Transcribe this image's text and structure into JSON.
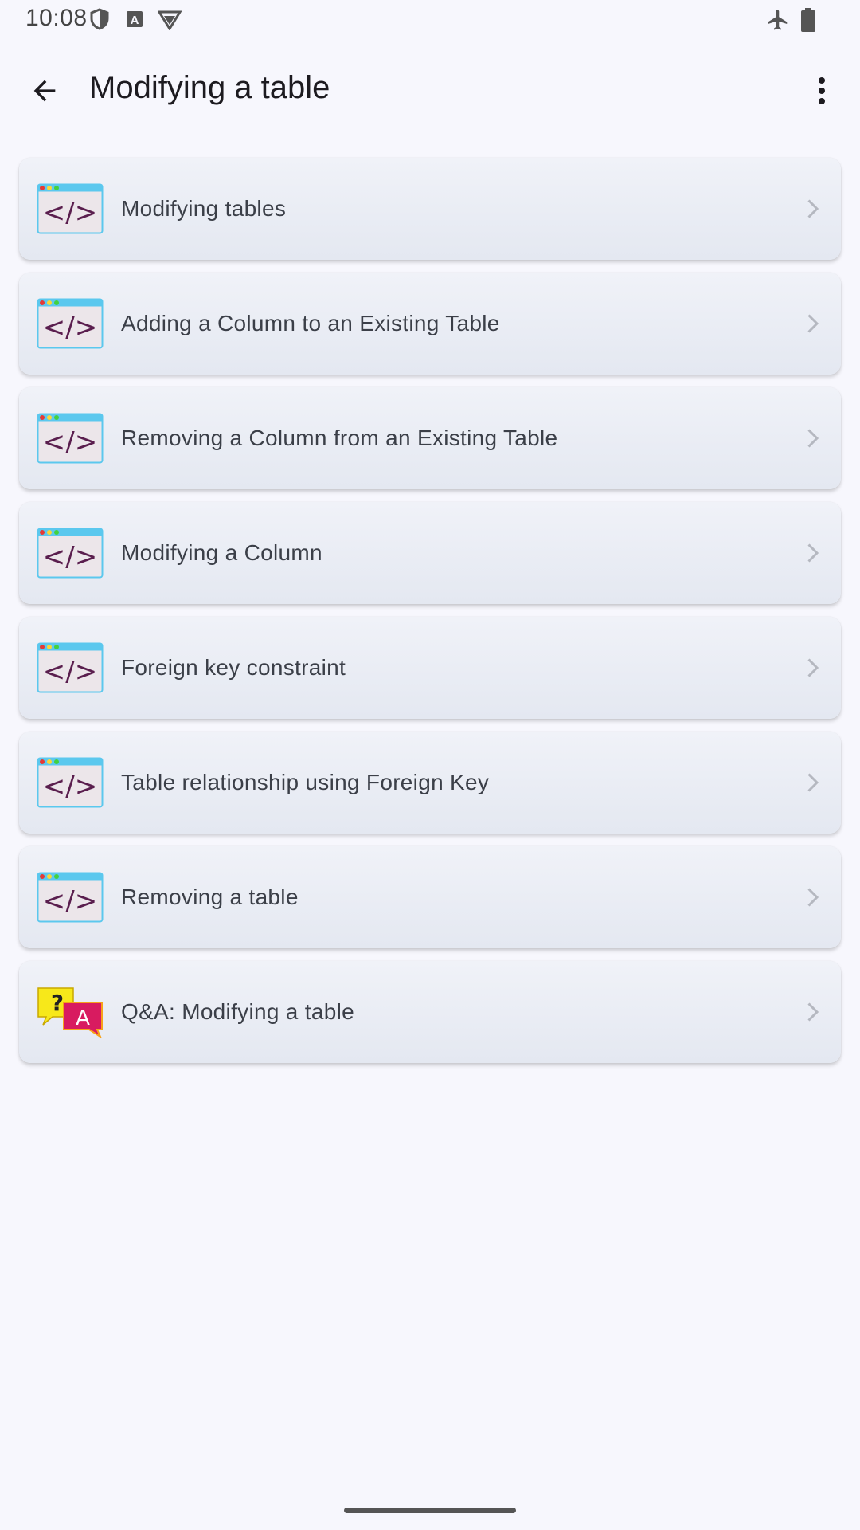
{
  "status_bar": {
    "time": "10:08",
    "left_icons": [
      "shield-icon",
      "font-a-icon",
      "vpn-triangle-icon"
    ],
    "right_icons": [
      "airplane-icon",
      "battery-icon"
    ]
  },
  "app_bar": {
    "title": "Modifying a table",
    "back_icon": "arrow-back-icon",
    "menu_icon": "more-vert-icon"
  },
  "items": [
    {
      "label": "Modifying tables",
      "icon": "code-window-icon"
    },
    {
      "label": "Adding a Column to an Existing Table",
      "icon": "code-window-icon"
    },
    {
      "label": "Removing a Column from an Existing Table",
      "icon": "code-window-icon"
    },
    {
      "label": "Modifying a Column",
      "icon": "code-window-icon"
    },
    {
      "label": "Foreign key constraint",
      "icon": "code-window-icon"
    },
    {
      "label": "Table relationship using Foreign Key",
      "icon": "code-window-icon"
    },
    {
      "label": "Removing a table",
      "icon": "code-window-icon"
    },
    {
      "label": "Q&A: Modifying a table",
      "icon": "qa-bubbles-icon"
    }
  ],
  "qa_icon_text": {
    "question": "?",
    "answer": "A"
  },
  "colors": {
    "background": "#f7f7fd",
    "code_icon_bar": "#5bc8ee",
    "code_icon_glyph": "#5a1e4e",
    "qa_yellow": "#f7e81a",
    "qa_pink": "#d81b60"
  }
}
